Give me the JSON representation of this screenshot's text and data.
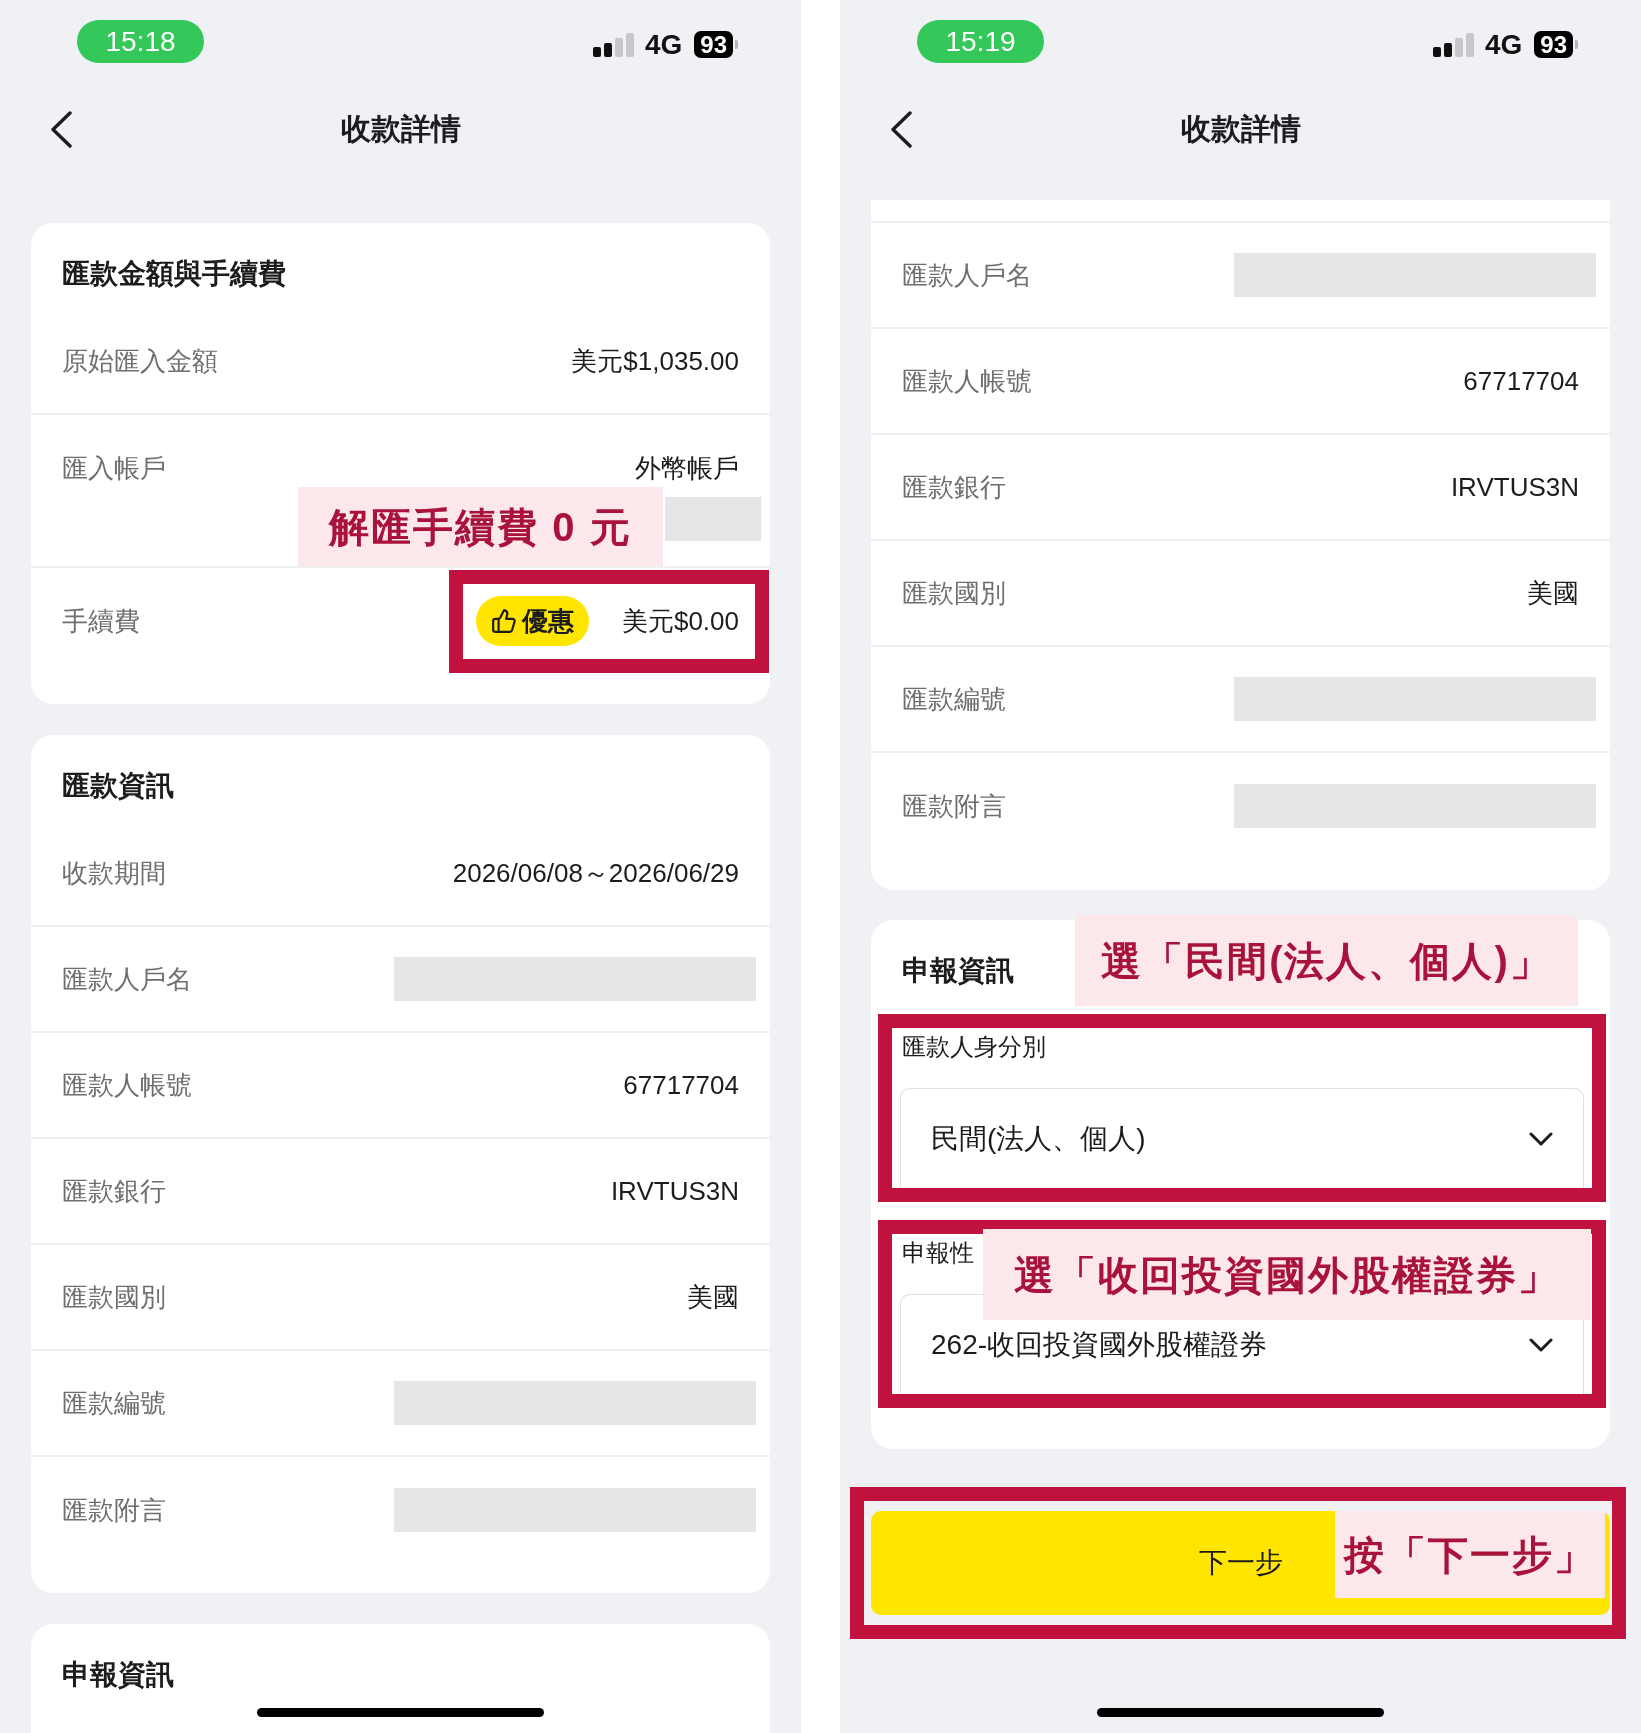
{
  "phones": [
    {
      "status_bar": {
        "time": "15:18",
        "network": "4G",
        "battery": "93"
      },
      "title": "收款詳情",
      "cards": [
        {
          "kind": "section",
          "heading": "匯款金額與手續費",
          "rows": [
            {
              "kind": "text",
              "label": "原始匯入金額",
              "value": "美元$1,035.00"
            },
            {
              "kind": "stacked",
              "label": "匯入帳戶",
              "value": "外幣帳戶",
              "note": "解匯手續費 0 元"
            },
            {
              "kind": "fee",
              "label": "手續費",
              "badge": "優惠",
              "value": "美元$0.00",
              "highlighted": true
            }
          ]
        },
        {
          "kind": "section",
          "heading": "匯款資訊",
          "rows": [
            {
              "kind": "text",
              "label": "收款期間",
              "value": "2026/06/08～2026/06/29"
            },
            {
              "kind": "redacted",
              "label": "匯款人戶名"
            },
            {
              "kind": "text",
              "label": "匯款人帳號",
              "value": "67717704"
            },
            {
              "kind": "text",
              "label": "匯款銀行",
              "value": "IRVTUS3N"
            },
            {
              "kind": "text",
              "label": "匯款國別",
              "value": "美國"
            },
            {
              "kind": "redacted",
              "label": "匯款編號"
            },
            {
              "kind": "redacted",
              "label": "匯款附言"
            }
          ]
        },
        {
          "kind": "section",
          "heading": "申報資訊"
        }
      ]
    },
    {
      "status_bar": {
        "time": "15:19",
        "network": "4G",
        "battery": "93"
      },
      "title": "收款詳情",
      "cards": [
        {
          "kind": "continued",
          "rows": [
            {
              "kind": "redacted",
              "label": "匯款人戶名"
            },
            {
              "kind": "text",
              "label": "匯款人帳號",
              "value": "67717704"
            },
            {
              "kind": "text",
              "label": "匯款銀行",
              "value": "IRVTUS3N"
            },
            {
              "kind": "text",
              "label": "匯款國別",
              "value": "美國"
            },
            {
              "kind": "redacted",
              "label": "匯款編號"
            },
            {
              "kind": "redacted",
              "label": "匯款附言"
            }
          ]
        },
        {
          "kind": "form",
          "heading": "申報資訊",
          "note": "選「民間(法人、個人)」",
          "fields": [
            {
              "label": "匯款人身分別",
              "value": "民間(法人、個人)",
              "highlighted": true
            },
            {
              "label": "申報性",
              "value": "262-收回投資國外股權證券",
              "highlighted": true,
              "note": "選「收回投資國外股權證券」"
            }
          ]
        }
      ],
      "button": {
        "label": "下一步",
        "highlighted": true,
        "note": "按「下一步」"
      }
    }
  ]
}
